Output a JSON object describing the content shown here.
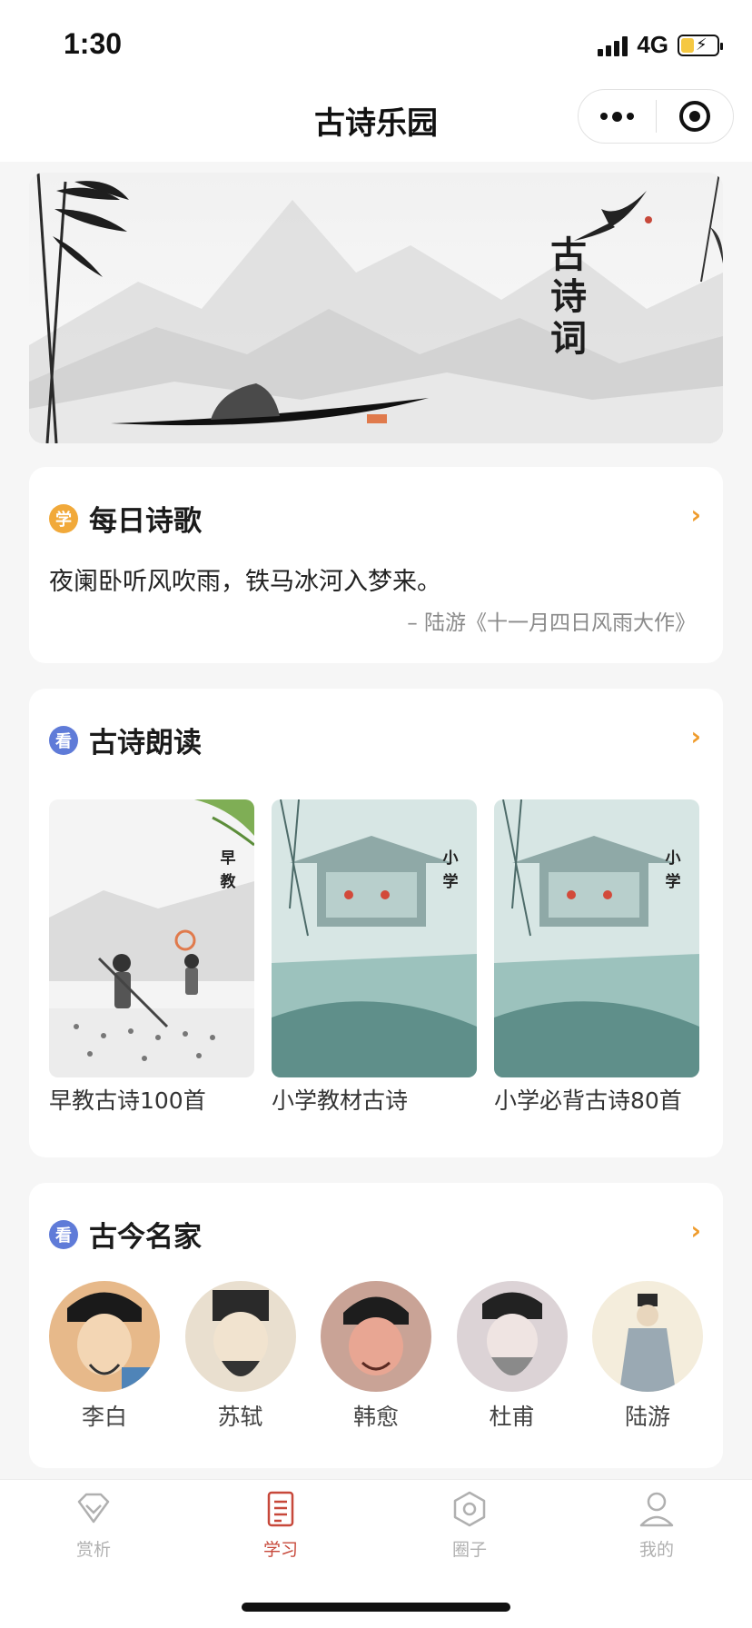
{
  "status_bar": {
    "time": "1:30",
    "network": "4G",
    "battery_icon": "battery-charging-icon",
    "signal_icon": "signal-icon"
  },
  "nav_bar": {
    "title": "古诗乐园",
    "more_icon": "more-dots-icon",
    "close_icon": "target-close-icon"
  },
  "banner": {
    "title": "古诗词"
  },
  "daily_poem": {
    "badge": "学",
    "title": "每日诗歌",
    "line": "夜阑卧听风吹雨，铁马冰河入梦来。",
    "source": "– 陆游《十一月四日风雨大作》",
    "arrow": "›"
  },
  "recitation": {
    "badge": "看",
    "title": "古诗朗读",
    "arrow": "›",
    "items": [
      {
        "label": "早教古诗100首",
        "cover_text": "早教"
      },
      {
        "label": "小学教材古诗",
        "cover_text": "小学"
      },
      {
        "label": "小学必背古诗80首",
        "cover_text": "小学"
      }
    ]
  },
  "poets": {
    "badge": "看",
    "title": "古今名家",
    "arrow": "›",
    "items": [
      {
        "name": "李白"
      },
      {
        "name": "苏轼"
      },
      {
        "name": "韩愈"
      },
      {
        "name": "杜甫"
      },
      {
        "name": "陆游"
      }
    ]
  },
  "tab_bar": {
    "active_color": "#c7483a",
    "inactive_color": "#b0b0b0",
    "tabs": [
      {
        "label": "赏析",
        "icon": "diamond-icon"
      },
      {
        "label": "学习",
        "icon": "document-icon"
      },
      {
        "label": "圈子",
        "icon": "hexagon-icon"
      },
      {
        "label": "我的",
        "icon": "person-icon"
      }
    ]
  }
}
